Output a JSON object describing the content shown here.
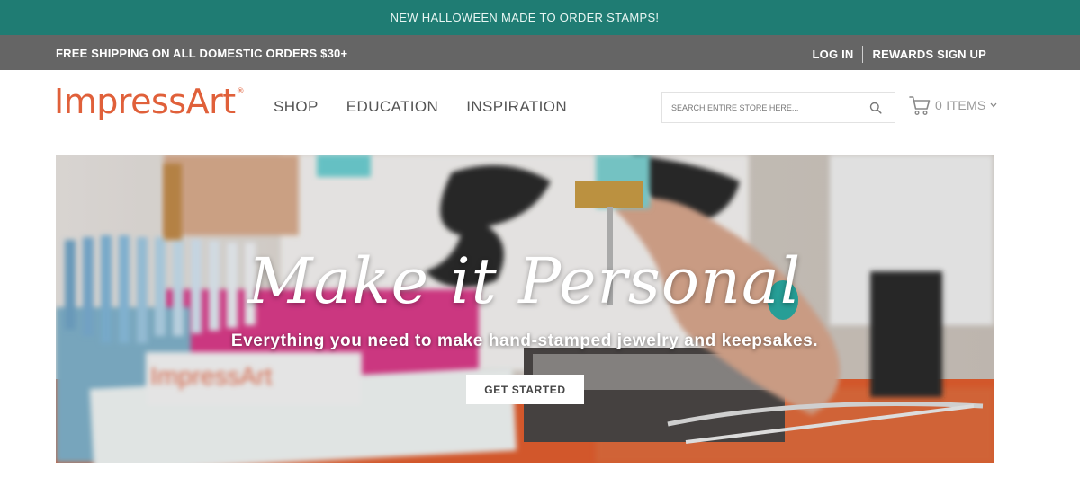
{
  "promo": {
    "text": "NEW HALLOWEEN MADE TO ORDER STAMPS!"
  },
  "utility": {
    "shipping": "FREE SHIPPING ON ALL DOMESTIC ORDERS $30+",
    "login": "LOG IN",
    "rewards": "REWARDS SIGN UP"
  },
  "header": {
    "logo": "ImpressArt",
    "logo_mark": "®",
    "nav": [
      {
        "label": "SHOP"
      },
      {
        "label": "EDUCATION"
      },
      {
        "label": "INSPIRATION"
      }
    ],
    "search": {
      "placeholder": "SEARCH ENTIRE STORE HERE...",
      "icon": "search-icon"
    },
    "cart": {
      "label": "0 ITEMS",
      "icon": "cart-icon"
    }
  },
  "hero": {
    "title": "Make it Personal",
    "subtitle": "Everything you need to make hand-stamped jewelry and keepsakes.",
    "cta": "GET STARTED"
  },
  "colors": {
    "promo_bg": "#1f7c73",
    "utility_bg": "#656565",
    "brand": "#e0603a"
  }
}
